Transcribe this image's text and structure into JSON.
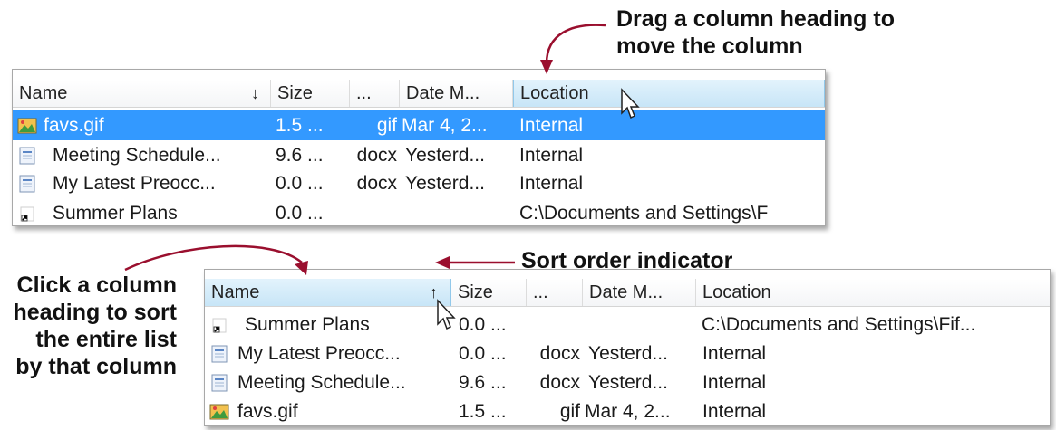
{
  "callouts": {
    "drag_line1": "Drag a column heading to",
    "drag_line2": "move the column",
    "sort_indicator": "Sort order indicator",
    "click_line1": "Click a column",
    "click_line2": "heading to sort",
    "click_line3": "the entire list",
    "click_line4": "by that column"
  },
  "top_list": {
    "columns": {
      "name": "Name",
      "size": "Size",
      "type": "...",
      "date": "Date M...",
      "location": "Location"
    },
    "sort_arrow": "↓",
    "rows": [
      {
        "icon": "image-file-icon",
        "name": "favs.gif",
        "size": "1.5 ...",
        "type": "gif",
        "date": "Mar 4, 2...",
        "location": "Internal"
      },
      {
        "icon": "document-file-icon",
        "name": "Meeting Schedule...",
        "size": "9.6 ...",
        "type": "docx",
        "date": "Yesterd...",
        "location": "Internal"
      },
      {
        "icon": "document-file-icon",
        "name": "My Latest Preocc...",
        "size": "0.0 ...",
        "type": "docx",
        "date": "Yesterd...",
        "location": "Internal"
      },
      {
        "icon": "shortcut-icon",
        "name": "Summer Plans",
        "size": "0.0 ...",
        "type": "",
        "date": "",
        "location": "C:\\Documents and Settings\\F"
      }
    ]
  },
  "bottom_list": {
    "columns": {
      "name": "Name",
      "size": "Size",
      "type": "...",
      "date": "Date M...",
      "location": "Location"
    },
    "sort_arrow": "↑",
    "rows": [
      {
        "icon": "shortcut-icon",
        "name": "Summer Plans",
        "size": "0.0 ...",
        "type": "",
        "date": "",
        "location": "C:\\Documents and Settings\\Fif..."
      },
      {
        "icon": "document-file-icon",
        "name": "My Latest Preocc...",
        "size": "0.0 ...",
        "type": "docx",
        "date": "Yesterd...",
        "location": "Internal"
      },
      {
        "icon": "document-file-icon",
        "name": "Meeting Schedule...",
        "size": "9.6 ...",
        "type": "docx",
        "date": "Yesterd...",
        "location": "Internal"
      },
      {
        "icon": "image-file-icon",
        "name": "favs.gif",
        "size": "1.5 ...",
        "type": "gif",
        "date": "Mar 4, 2...",
        "location": "Internal"
      }
    ]
  },
  "colors": {
    "accent_arrow": "#9a0f2e",
    "selection": "#3399ff",
    "hover_header": "#c7e5f7"
  }
}
